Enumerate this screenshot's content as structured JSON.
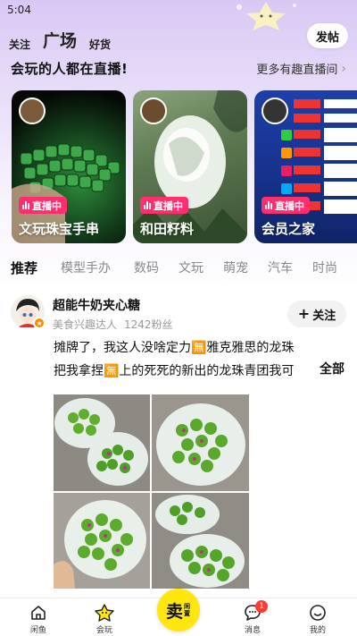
{
  "status_bar": {
    "time": "5:04"
  },
  "top_nav": {
    "tabs": [
      {
        "label": "关注",
        "active": false
      },
      {
        "label": "广场",
        "active": true
      },
      {
        "label": "好货",
        "active": false
      }
    ],
    "post_button": "发帖"
  },
  "live_section": {
    "title": "会玩的人都在直播!",
    "more_link": "更多有趣直播间",
    "badge_label": "直播中",
    "cards": [
      {
        "title": "文玩珠宝手串"
      },
      {
        "title": "和田籽料"
      },
      {
        "title": "会员之家"
      }
    ]
  },
  "category_tabs": [
    {
      "label": "推荐",
      "active": true
    },
    {
      "label": "模型手办",
      "active": false
    },
    {
      "label": "数码",
      "active": false
    },
    {
      "label": "文玩",
      "active": false
    },
    {
      "label": "萌宠",
      "active": false
    },
    {
      "label": "汽车",
      "active": false
    },
    {
      "label": "时尚",
      "active": false
    }
  ],
  "post": {
    "user_name": "超能牛奶夹心糖",
    "user_tag": "美食兴趣达人",
    "fans": "1242粉丝",
    "follow_label": "关注",
    "text": "摊牌了，我这人没啥定力🈚雅克雅思的龙珠把我拿捏🈚上的死死的新出的龙珠青团我可",
    "expand_label": "全部"
  },
  "bottom_tabs": [
    {
      "label": "闲鱼",
      "icon": "home-icon"
    },
    {
      "label": "会玩",
      "icon": "star-icon"
    },
    {
      "label": "消息",
      "icon": "message-icon",
      "badge": "1"
    },
    {
      "label": "我的",
      "icon": "profile-icon"
    }
  ],
  "center_button": {
    "big": "卖",
    "small": "闲置"
  },
  "colors": {
    "accent": "#ffe60f",
    "live_badge": "#ff2f6e",
    "notify": "#ff3b30"
  }
}
